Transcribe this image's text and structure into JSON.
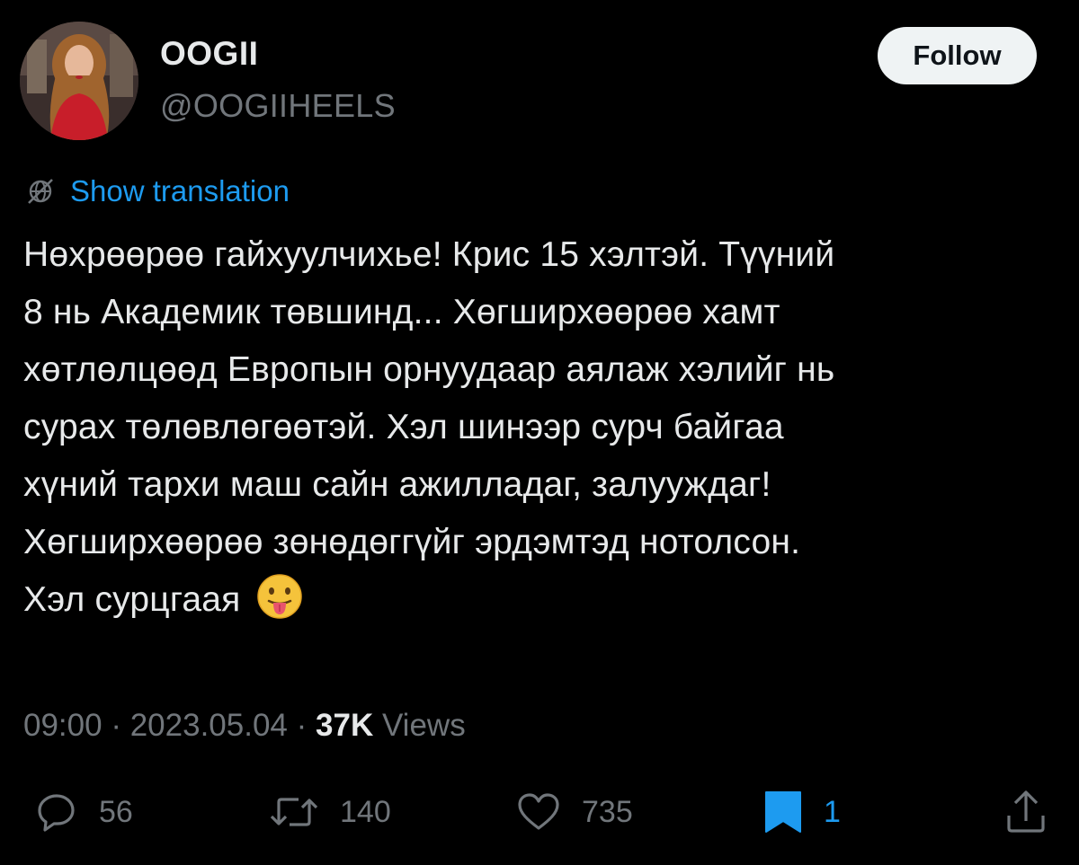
{
  "user": {
    "display_name": "OOGII",
    "handle": "@OOGIIHEELS"
  },
  "follow_label": "Follow",
  "translation_label": "Show translation",
  "tweet": {
    "lines": [
      "Нөхрөөрөө гайхуулчихье! Крис 15 хэлтэй. Түүний",
      "8 нь Академик төвшинд... Хөгширхөөрөө хамт",
      "хөтлөлцөөд Европын орнуудаар аялаж хэлийг нь",
      "сурах төлөвлөгөөтэй. Хэл шинээр сурч байгаа",
      "хүний тархи маш сайн ажилладаг, залууждаг!",
      "Хөгширхөөрөө зөнөдөггүйг эрдэмтэд нотолсон.",
      "Хэл сурцгаая"
    ],
    "emoji": "face-with-tongue-emoji"
  },
  "meta": {
    "time": "09:00",
    "separator": "·",
    "date": "2023.05.04",
    "views_count": "37K",
    "views_label": "Views"
  },
  "actions": {
    "reply_count": "56",
    "retweet_count": "140",
    "like_count": "735",
    "bookmark_count": "1"
  },
  "icons": {
    "translation": "globe-slash-icon",
    "reply": "reply-bubble-icon",
    "retweet": "retweet-icon",
    "like": "heart-icon",
    "bookmark": "bookmark-filled-icon",
    "share": "share-upload-icon"
  },
  "colors": {
    "background": "#000000",
    "text": "#e7e9ea",
    "muted": "#71767b",
    "accent": "#1d9bf0",
    "follow_bg": "#eff3f4"
  }
}
